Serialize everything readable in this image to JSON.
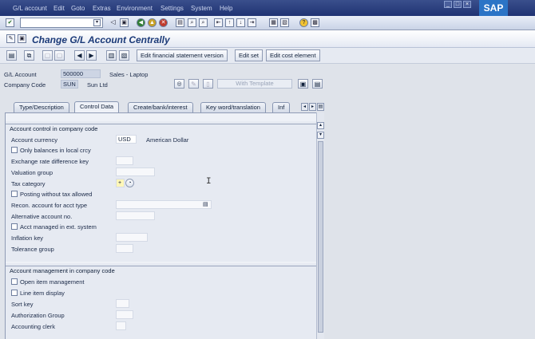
{
  "menubar": {
    "items": [
      "G/L account",
      "Edit",
      "Goto",
      "Extras",
      "Environment",
      "Settings",
      "System",
      "Help"
    ],
    "logo": "SAP"
  },
  "toolbar": {
    "command_field": "",
    "icons": [
      "enter-icon",
      "save-icon",
      "back-icon",
      "exit-icon",
      "cancel-icon",
      "print-icon",
      "find-icon",
      "find-next-icon",
      "first-page-icon",
      "prev-page-icon",
      "next-page-icon",
      "last-page-icon",
      "create-session-icon",
      "shortcut-icon",
      "help-icon",
      "customize-icon"
    ]
  },
  "title": "Change G/L Account Centrally",
  "app_toolbar": {
    "buttons": [
      "Edit financial statement version",
      "Edit set",
      "Edit cost element"
    ]
  },
  "header": {
    "gl_account_label": "G/L Account",
    "gl_account_value": "500000",
    "gl_account_desc": "Sales - Laptop",
    "company_code_label": "Company Code",
    "company_code_value": "SUN",
    "company_code_desc": "Sun Ltd",
    "with_template": "With Template"
  },
  "tabs": [
    "Type/Description",
    "Control Data",
    "Create/bank/interest",
    "Key word/translation",
    "Inf"
  ],
  "active_tab": "Control Data",
  "account_control": {
    "title": "Account control in company code",
    "account_currency_label": "Account currency",
    "account_currency_value": "USD",
    "account_currency_desc": "American Dollar",
    "only_balances": "Only balances in local crcy",
    "exchange_rate_key": "Exchange rate difference key",
    "valuation_group": "Valuation group",
    "tax_category": "Tax category",
    "tax_category_value": "+",
    "posting_without_tax": "Posting without tax allowed",
    "recon_account": "Recon. account for acct type",
    "alt_account": "Alternative account no.",
    "acct_managed_ext": "Acct managed in ext. system",
    "inflation_key": "Inflation key",
    "tolerance_group": "Tolerance group"
  },
  "account_management": {
    "title": "Account management in company code",
    "open_item_mgmt": "Open item management",
    "line_item_display": "Line item display",
    "sort_key": "Sort key",
    "authorization_group": "Authorization Group",
    "accounting_clerk": "Accounting clerk"
  },
  "colors": {
    "menubar": "#1f3373",
    "title_text": "#1b3a78",
    "panel": "#eef1f7"
  }
}
